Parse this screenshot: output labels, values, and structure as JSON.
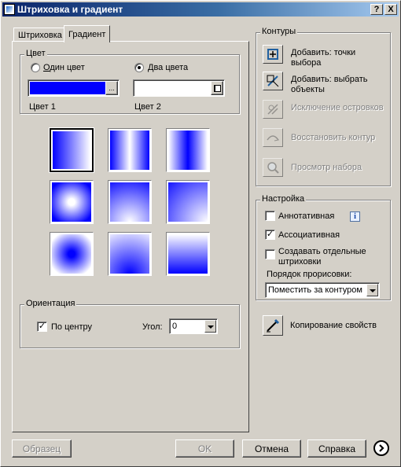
{
  "window": {
    "title": "Штриховка и градиент",
    "help_btn": "?",
    "close_btn": "X"
  },
  "tabs": [
    {
      "label": "Штриховка"
    },
    {
      "label": "Градиент"
    }
  ],
  "color": {
    "legend": "Цвет",
    "one_color_label": "Один цвет",
    "two_color_label": "Два цвета",
    "selected_mode": "two_colors",
    "color1_label": "Цвет 1",
    "color2_label": "Цвет 2",
    "color1_value": "#0000ff",
    "color2_value": "#ffffff",
    "browse_label": "..."
  },
  "gradient_swatches": [
    {
      "pattern": "linear-horizontal-fade",
      "selected": true
    },
    {
      "pattern": "cylinder-horizontal",
      "selected": false
    },
    {
      "pattern": "inverted-cylinder-horizontal",
      "selected": false
    },
    {
      "pattern": "spherical-inverted",
      "selected": false
    },
    {
      "pattern": "hemispherical",
      "selected": false
    },
    {
      "pattern": "curved-corner",
      "selected": false
    },
    {
      "pattern": "spherical",
      "selected": false
    },
    {
      "pattern": "inverted-hemispherical",
      "selected": false
    },
    {
      "pattern": "curved",
      "selected": false
    }
  ],
  "orientation": {
    "legend": "Ориентация",
    "centered_label": "По центру",
    "centered_checked": true,
    "angle_label": "Угол:",
    "angle_value": "0"
  },
  "contours": {
    "legend": "Контуры",
    "items": [
      {
        "label": "Добавить: точки выбора",
        "enabled": true,
        "icon": "add-pick-points-icon"
      },
      {
        "label": "Добавить: выбрать объекты",
        "enabled": true,
        "icon": "add-select-objects-icon"
      },
      {
        "label": "Исключение островков",
        "enabled": false,
        "icon": "remove-islands-icon"
      },
      {
        "label": "Восстановить контур",
        "enabled": false,
        "icon": "recreate-boundary-icon"
      },
      {
        "label": "Просмотр набора",
        "enabled": false,
        "icon": "view-selections-icon"
      }
    ]
  },
  "settings": {
    "legend": "Настройка",
    "annotative_label": "Аннотативная",
    "annotative_checked": false,
    "associative_label": "Ассоциативная",
    "associative_checked": true,
    "separate_label": "Создавать отдельные штриховки",
    "separate_checked": false,
    "draw_order_label": "Порядок прорисовки:",
    "draw_order_value": "Поместить за контуром"
  },
  "inherit": {
    "label": "Копирование свойств",
    "icon": "inherit-properties-icon"
  },
  "footer": {
    "preview_label": "Образец",
    "ok_label": "OK",
    "cancel_label": "Отмена",
    "help_label": "Справка"
  }
}
